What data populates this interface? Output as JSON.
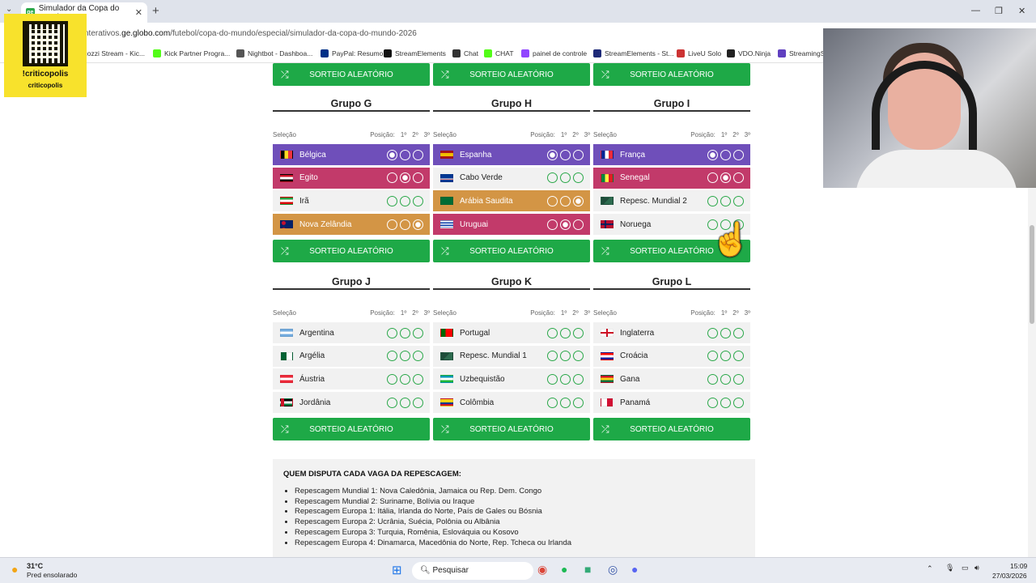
{
  "browser": {
    "tab_title": "Simulador da Copa do Mundo",
    "tab_favicon": "ge",
    "url_prefix": "nterativos.",
    "url_domain": "ge.globo.com",
    "url_path": "/futebol/copa-do-mundo/especial/simulador-da-copa-do-mundo-2026",
    "bookmarks": [
      "uozzi Stream - Kic...",
      "Kick Partner Progra...",
      "Nightbot - Dashboa...",
      "PayPal: Resumo",
      "StreamElements",
      "Chat",
      "CHAT",
      "painel de controle",
      "StreamElements - St...",
      "LiveU Solo",
      "VDO.Ninja",
      "StreamingS"
    ]
  },
  "overlay": {
    "qr_line1": "!criticopolis",
    "qr_line2": "criticopolis"
  },
  "buttons": {
    "random_draw": "SORTEIO ALEATÓRIO"
  },
  "labels": {
    "selecao": "Seleção",
    "posicao": "Posição:",
    "p1": "1º",
    "p2": "2º",
    "p3": "3º"
  },
  "groups": [
    {
      "title": "Grupo G",
      "teams": [
        {
          "name": "Bélgica",
          "pos": 1
        },
        {
          "name": "Egito",
          "pos": 2
        },
        {
          "name": "Irã",
          "pos": 0
        },
        {
          "name": "Nova Zelândia",
          "pos": 3
        }
      ]
    },
    {
      "title": "Grupo H",
      "teams": [
        {
          "name": "Espanha",
          "pos": 1
        },
        {
          "name": "Cabo Verde",
          "pos": 0
        },
        {
          "name": "Arábia Saudita",
          "pos": 3
        },
        {
          "name": "Uruguai",
          "pos": 2
        }
      ]
    },
    {
      "title": "Grupo I",
      "teams": [
        {
          "name": "França",
          "pos": 1
        },
        {
          "name": "Senegal",
          "pos": 2
        },
        {
          "name": "Repesc. Mundial 2",
          "pos": 0
        },
        {
          "name": "Noruega",
          "pos": 0
        }
      ]
    },
    {
      "title": "Grupo J",
      "teams": [
        {
          "name": "Argentina",
          "pos": 0
        },
        {
          "name": "Argélia",
          "pos": 0
        },
        {
          "name": "Áustria",
          "pos": 0
        },
        {
          "name": "Jordânia",
          "pos": 0
        }
      ]
    },
    {
      "title": "Grupo K",
      "teams": [
        {
          "name": "Portugal",
          "pos": 0
        },
        {
          "name": "Repesc. Mundial 1",
          "pos": 0
        },
        {
          "name": "Uzbequistão",
          "pos": 0
        },
        {
          "name": "Colômbia",
          "pos": 0
        }
      ]
    },
    {
      "title": "Grupo L",
      "teams": [
        {
          "name": "Inglaterra",
          "pos": 0
        },
        {
          "name": "Croácia",
          "pos": 0
        },
        {
          "name": "Gana",
          "pos": 0
        },
        {
          "name": "Panamá",
          "pos": 0
        }
      ]
    }
  ],
  "colors": {
    "pos1": "#6f4fba",
    "pos2": "#c23a6a",
    "pos3": "#d39545",
    "none": "#f1f1f1",
    "button": "#1ea947"
  },
  "repescagem": {
    "title": "QUEM DISPUTA CADA VAGA DA REPESCAGEM:",
    "items": [
      "Repescagem Mundial 1: Nova Caledônia, Jamaica ou Rep. Dem. Congo",
      "Repescagem Mundial 2: Suriname, Bolívia ou Iraque",
      "Repescagem Europa 1: Itália, Irlanda do Norte, País de Gales ou Bósnia",
      "Repescagem Europa 2: Ucrânia, Suécia, Polônia ou Albânia",
      "Repescagem Europa 3: Turquia, Romênia, Eslováquia ou Kosovo",
      "Repescagem Europa 4: Dinamarca, Macedônia do Norte, Rep. Tcheca ou Irlanda"
    ]
  },
  "taskbar": {
    "temp": "31°C",
    "weather": "Pred ensolarado",
    "search": "Pesquisar",
    "time": "15:09",
    "date": "27/03/2026"
  }
}
